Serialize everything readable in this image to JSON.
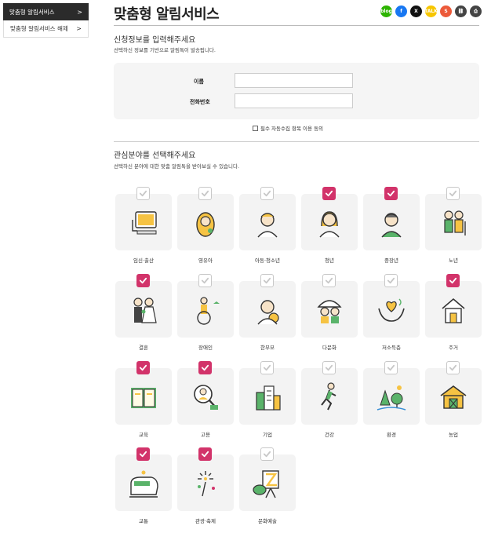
{
  "sidebar": {
    "items": [
      {
        "label": "맞춤형 알림서비스",
        "chevron": ">"
      },
      {
        "label": "맞춤형 알림서비스 해제",
        "chevron": ">"
      }
    ]
  },
  "header": {
    "title": "맞춤형 알림서비스",
    "share_icons": [
      {
        "name": "blog-icon",
        "text": "blog",
        "color": "#2db400"
      },
      {
        "name": "facebook-icon",
        "text": "f",
        "color": "#1877f2"
      },
      {
        "name": "x-icon",
        "text": "X",
        "color": "#111111"
      },
      {
        "name": "kakaotalk-icon",
        "text": "TALK",
        "color": "#f7c600"
      },
      {
        "name": "kakaostory-icon",
        "text": "S",
        "color": "#ec5a3a"
      },
      {
        "name": "link-icon",
        "text": "⛓",
        "color": "#444444"
      },
      {
        "name": "print-icon",
        "text": "⎙",
        "color": "#444444"
      }
    ]
  },
  "form_section": {
    "title": "신청정보를 입력해주세요",
    "subtitle": "선택하신 정보를 기반으로 알림톡이 발송됩니다.",
    "name_label": "이름",
    "name_value": "",
    "phone_label": "전화번호",
    "phone_value": "",
    "agree_label": "필수 자동수집 항목 이용 동의"
  },
  "interest_section": {
    "title": "관심분야를 선택해주세요",
    "subtitle": "선택하신 분야에 대한 맞춤 알림톡을 받아보실 수 있습니다."
  },
  "categories": [
    {
      "label": "임신·출산",
      "icon": "pregnancy-ultrasound-icon",
      "checked": false
    },
    {
      "label": "영유아",
      "icon": "infant-icon",
      "checked": false
    },
    {
      "label": "아동·청소년",
      "icon": "child-icon",
      "checked": false
    },
    {
      "label": "청년",
      "icon": "youth-icon",
      "checked": true
    },
    {
      "label": "중장년",
      "icon": "middle-aged-icon",
      "checked": true
    },
    {
      "label": "노년",
      "icon": "elderly-icon",
      "checked": false
    },
    {
      "label": "결혼",
      "icon": "wedding-icon",
      "checked": true
    },
    {
      "label": "장애인",
      "icon": "wheelchair-icon",
      "checked": false
    },
    {
      "label": "한부모",
      "icon": "single-parent-icon",
      "checked": false
    },
    {
      "label": "다문화",
      "icon": "multicultural-family-icon",
      "checked": false
    },
    {
      "label": "저소득층",
      "icon": "low-income-hands-heart-icon",
      "checked": false
    },
    {
      "label": "주거",
      "icon": "house-icon",
      "checked": true
    },
    {
      "label": "교육",
      "icon": "book-icon",
      "checked": true
    },
    {
      "label": "고용",
      "icon": "employment-icon",
      "checked": true
    },
    {
      "label": "기업",
      "icon": "buildings-icon",
      "checked": false
    },
    {
      "label": "건강",
      "icon": "running-icon",
      "checked": false
    },
    {
      "label": "환경",
      "icon": "nature-icon",
      "checked": false
    },
    {
      "label": "농업",
      "icon": "barn-icon",
      "checked": false
    },
    {
      "label": "교통",
      "icon": "train-icon",
      "checked": true
    },
    {
      "label": "관광·축제",
      "icon": "fireworks-icon",
      "checked": true
    },
    {
      "label": "문화예술",
      "icon": "art-easel-icon",
      "checked": false
    }
  ],
  "colors": {
    "check_on": "#d2336a",
    "sidebar_active_bg": "#2b2b2b",
    "icon_line": "#333333",
    "icon_yellow": "#f6c343",
    "icon_green": "#5ab36a"
  }
}
